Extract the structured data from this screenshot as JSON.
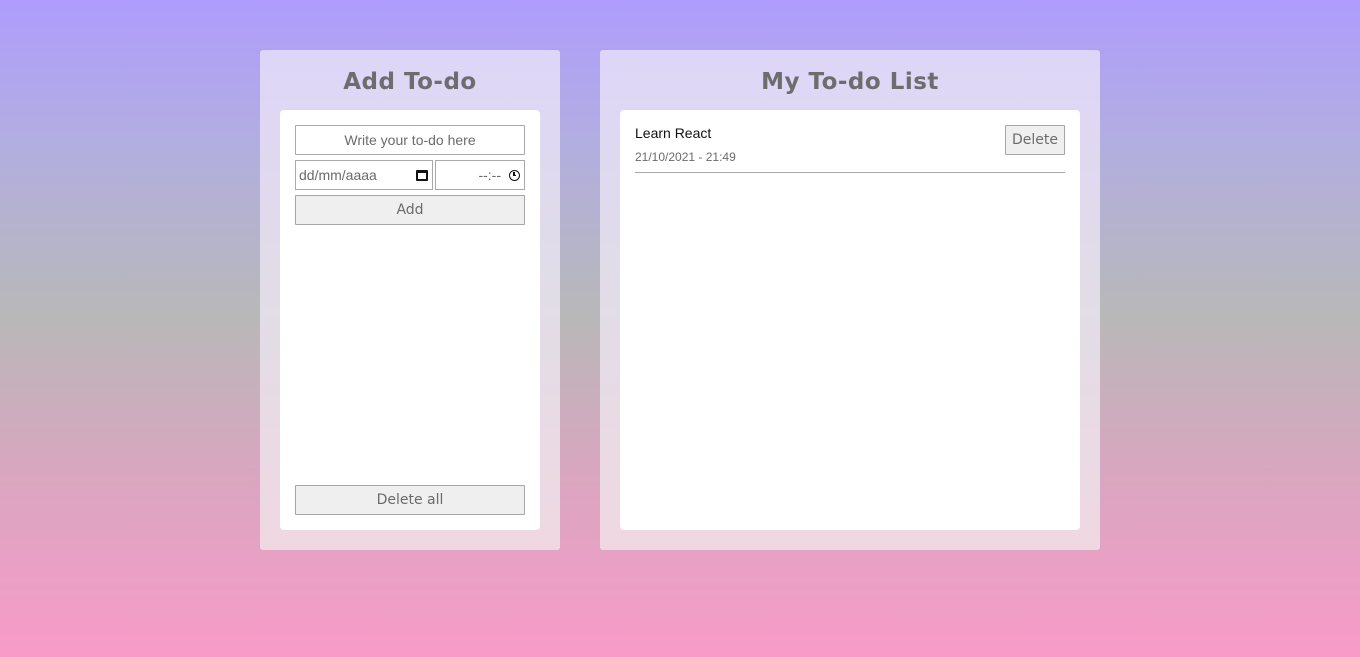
{
  "add_panel": {
    "title": "Add To-do",
    "todo_input": {
      "value": "",
      "placeholder": "Write your to-do here"
    },
    "date_input": {
      "placeholder": "dd/mm/aaaa"
    },
    "time_input": {
      "placeholder": "--:--"
    },
    "add_label": "Add",
    "delete_all_label": "Delete all"
  },
  "list_panel": {
    "title": "My To-do List",
    "items": [
      {
        "title": "Learn React",
        "datetime": "21/10/2021 - 21:49",
        "delete_label": "Delete"
      }
    ]
  },
  "icons": {
    "date_picker": "calendar-icon",
    "time_picker": "clock-icon"
  }
}
